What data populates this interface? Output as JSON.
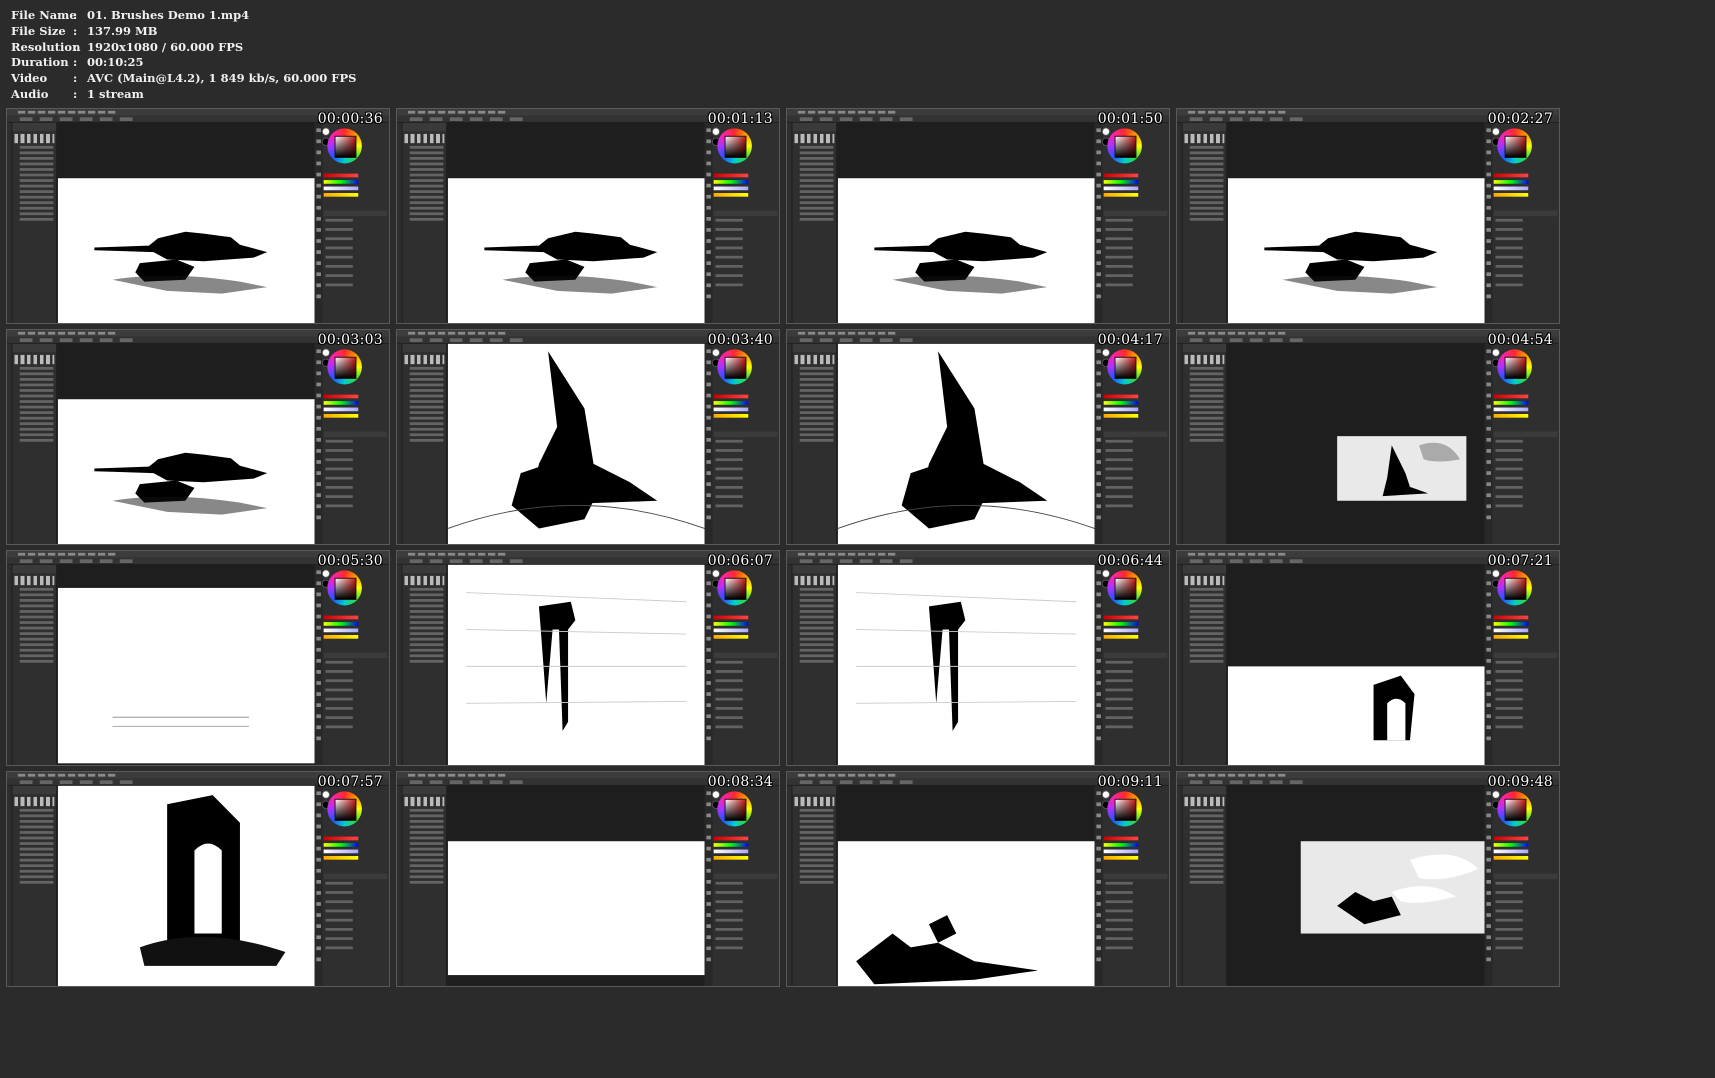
{
  "file_info": [
    {
      "key": "File Name",
      "sep": ":",
      "value": "01. Brushes Demo 1.mp4"
    },
    {
      "key": "File Size",
      "sep": ":",
      "value": "137.99 MB"
    },
    {
      "key": "Resolution",
      "sep": ":",
      "value": "1920x1080 / 60.000 FPS"
    },
    {
      "key": "Duration",
      "sep": ":",
      "value": "00:10:25"
    },
    {
      "key": "Video",
      "sep": ":",
      "value": "AVC (Main@L4.2), 1 849 kb/s, 60.000 FPS"
    },
    {
      "key": "Audio",
      "sep": ":",
      "value": "1 stream"
    }
  ],
  "thumbnails": [
    {
      "timestamp": "00:00:36",
      "scene": "tank"
    },
    {
      "timestamp": "00:01:13",
      "scene": "tank"
    },
    {
      "timestamp": "00:01:50",
      "scene": "tank"
    },
    {
      "timestamp": "00:02:27",
      "scene": "tank"
    },
    {
      "timestamp": "00:03:03",
      "scene": "tank"
    },
    {
      "timestamp": "00:03:40",
      "scene": "spire"
    },
    {
      "timestamp": "00:04:17",
      "scene": "spire"
    },
    {
      "timestamp": "00:04:54",
      "scene": "spire-clouds"
    },
    {
      "timestamp": "00:05:30",
      "scene": "blank-lines"
    },
    {
      "timestamp": "00:06:07",
      "scene": "column"
    },
    {
      "timestamp": "00:06:44",
      "scene": "column"
    },
    {
      "timestamp": "00:07:21",
      "scene": "arch"
    },
    {
      "timestamp": "00:07:57",
      "scene": "arch-large"
    },
    {
      "timestamp": "00:08:34",
      "scene": "blank"
    },
    {
      "timestamp": "00:09:11",
      "scene": "rubble"
    },
    {
      "timestamp": "00:09:48",
      "scene": "rubble-clouds"
    }
  ],
  "colors": {
    "background": "#2b2b2b",
    "panel": "#2f2f2f",
    "canvas_bg": "#1e1e1e",
    "frame_border": "#5a5a5a",
    "timestamp_text": "#ffffff"
  }
}
